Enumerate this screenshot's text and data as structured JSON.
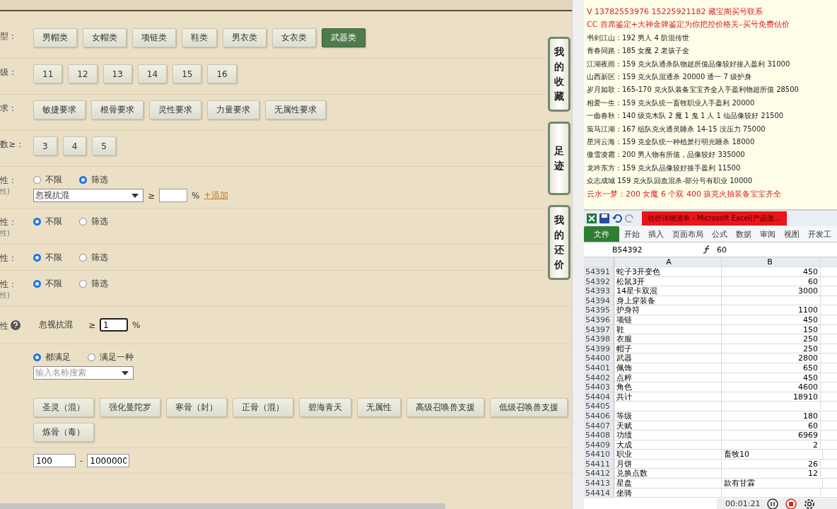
{
  "filters": [
    {
      "kind": "buttons",
      "label": "型：",
      "options": [
        {
          "label": "男帽类",
          "selected": false
        },
        {
          "label": "女帽类",
          "selected": false
        },
        {
          "label": "项链类",
          "selected": false
        },
        {
          "label": "鞋类",
          "selected": false
        },
        {
          "label": "男衣类",
          "selected": false
        },
        {
          "label": "女衣类",
          "selected": false
        },
        {
          "label": "武器类",
          "selected": true
        }
      ]
    },
    {
      "kind": "buttons",
      "label": "级：",
      "options": [
        {
          "label": "11",
          "selected": false
        },
        {
          "label": "12",
          "selected": false
        },
        {
          "label": "13",
          "selected": false
        },
        {
          "label": "14",
          "selected": false
        },
        {
          "label": "15",
          "selected": false
        },
        {
          "label": "16",
          "selected": false
        }
      ]
    },
    {
      "kind": "buttons",
      "label": "求：",
      "options": [
        {
          "label": "敏捷要求",
          "selected": false
        },
        {
          "label": "根骨要求",
          "selected": false
        },
        {
          "label": "灵性要求",
          "selected": false
        },
        {
          "label": "力量要求",
          "selected": false
        },
        {
          "label": "无属性要求",
          "selected": false
        }
      ]
    },
    {
      "kind": "buttons",
      "label": "数≥：",
      "options": [
        {
          "label": "3",
          "selected": false
        },
        {
          "label": "4",
          "selected": false
        },
        {
          "label": "5",
          "selected": false
        }
      ]
    },
    {
      "kind": "radio",
      "label": "性：",
      "sublabel": "性)",
      "options": [
        {
          "label": "不限",
          "selected": false
        },
        {
          "label": "筛选",
          "selected": true
        }
      ],
      "condition": {
        "select": "忽视抗混",
        "op": "≥",
        "unit": "%",
        "link": "+添加"
      }
    },
    {
      "kind": "radio",
      "label": "性：",
      "sublabel": "性)",
      "options": [
        {
          "label": "不限",
          "selected": true
        },
        {
          "label": "筛选",
          "selected": false
        }
      ]
    },
    {
      "kind": "radio",
      "label": "性：",
      "options": [
        {
          "label": "不限",
          "selected": true
        },
        {
          "label": "筛选",
          "selected": false
        }
      ]
    },
    {
      "kind": "radio",
      "label": "性：",
      "sublabel": "性)",
      "options": [
        {
          "label": "不限",
          "selected": true
        },
        {
          "label": "筛选",
          "selected": false
        }
      ]
    },
    {
      "kind": "threshold",
      "label": "性",
      "name": "忽视抗混",
      "op": "≥",
      "value": "1",
      "unit": "%"
    },
    {
      "kind": "multi",
      "options": [
        {
          "label": "都满足",
          "selected": true
        },
        {
          "label": "满足一种",
          "selected": false
        }
      ],
      "search": {
        "placeholder": "输入名称搜索"
      },
      "tags": [
        "圣灵（混）",
        "强化曼陀罗",
        "寒骨（封）",
        "正骨（混）",
        "碧海青天",
        "无属性",
        "高级召唤兽支援",
        "低级召唤兽支援",
        "炼骨（毒）"
      ]
    },
    {
      "kind": "range",
      "from": "100",
      "sep": "-",
      "to": "1000000"
    }
  ],
  "side_tabs": [
    "我的收藏",
    "足迹",
    "我的还价"
  ],
  "notes": [
    {
      "text": "V 13782553976    15225921182   藏宝阁买号联系",
      "emphasis": true
    },
    {
      "text": "CC 首席鉴定+大神金牌鉴定为你把控价格关–买号免费估价",
      "emphasis": true
    },
    {
      "text": "书剑江山：192 男人 4 阶混传世",
      "emphasis": false
    },
    {
      "text": "青春同路：185 女魔 2 老孩子全",
      "emphasis": false
    },
    {
      "text": "江湖夜雨：159 克火队通杀队物超所值品像较好接入盈利 31000",
      "emphasis": false
    },
    {
      "text": "山西新区：159 克火队混通杀 20000 通一 7 级护身",
      "emphasis": false
    },
    {
      "text": "岁月如歌：165-170 克火队装备宝宝齐全入手盈利物超所值 28500",
      "emphasis": false
    },
    {
      "text": "相爱一生：159 克火队统一畜牧职业入手盈利 20000",
      "emphasis": false
    },
    {
      "text": "一曲春秋：140 级克木队 2 魔 1 鬼 1 人 1 仙品像较好 21500",
      "emphasis": false
    },
    {
      "text": "策马江湖：167 组队克火通灵睡杀 14-15 没压力 75000",
      "emphasis": false
    },
    {
      "text": "星河云海：159 克全队统一种植景行明光睡杀 18000",
      "emphasis": false
    },
    {
      "text": "傲雪凌霜：200 男人物有所值，品像较好 335000",
      "emphasis": false
    },
    {
      "text": "龙吟东方：159 克火队品像较好接手盈利 11500",
      "emphasis": false
    },
    {
      "text": "众志成城 159 克火队回血混杀-部分号有职业 10000",
      "emphasis": false
    },
    {
      "text": "云水一梦：200 女魔 6 个双 400 孩克火抽装备宝宝齐全",
      "emphasis": true
    }
  ],
  "excel": {
    "title": "估价详细清单 - Microsoft Excel(产品激...",
    "tabs": [
      {
        "label": "文件",
        "selected": true
      },
      {
        "label": "开始",
        "selected": false
      },
      {
        "label": "插入",
        "selected": false
      },
      {
        "label": "页面布局",
        "selected": false
      },
      {
        "label": "公式",
        "selected": false
      },
      {
        "label": "数据",
        "selected": false
      },
      {
        "label": "审阅",
        "selected": false
      },
      {
        "label": "视图",
        "selected": false
      },
      {
        "label": "开发工",
        "selected": false
      }
    ],
    "name_box": "B54392",
    "formula": "60",
    "columns": [
      "A",
      "B"
    ],
    "rows": [
      {
        "num": "54391",
        "a": "蛇子3开变色",
        "b": "450",
        "kind": "number"
      },
      {
        "num": "54392",
        "a": "松鼠3开",
        "b": "60",
        "kind": "number"
      },
      {
        "num": "54393",
        "a": "14星卡双混",
        "b": "3000",
        "kind": "number"
      },
      {
        "num": "54394",
        "a": "身上穿装备",
        "kind": "number"
      },
      {
        "num": "54395",
        "a": "护身符",
        "b": "1100",
        "kind": "number"
      },
      {
        "num": "54396",
        "a": "项链",
        "b": "450",
        "kind": "number"
      },
      {
        "num": "54397",
        "a": "鞋",
        "b": "150",
        "kind": "number"
      },
      {
        "num": "54398",
        "a": "衣服",
        "b": "250",
        "kind": "number"
      },
      {
        "num": "54399",
        "a": "帽子",
        "b": "250",
        "kind": "number"
      },
      {
        "num": "54400",
        "a": "武器",
        "b": "2800",
        "kind": "number"
      },
      {
        "num": "54401",
        "a": "佩饰",
        "b": "650",
        "kind": "number"
      },
      {
        "num": "54402",
        "a": "点粹",
        "b": "450",
        "kind": "number"
      },
      {
        "num": "54403",
        "a": "角色",
        "b": "4600",
        "kind": "number"
      },
      {
        "num": "54404",
        "a": "共计",
        "b": "18910",
        "kind": "number"
      },
      {
        "num": "54405",
        "kind": "number"
      },
      {
        "num": "54406",
        "a": "等级",
        "b": "180",
        "kind": "number"
      },
      {
        "num": "54407",
        "a": "天赋",
        "b": "60",
        "kind": "number"
      },
      {
        "num": "54408",
        "a": "功绩",
        "b": "6969",
        "kind": "number"
      },
      {
        "num": "54409",
        "a": "大成",
        "b": "2",
        "kind": "number"
      },
      {
        "num": "54410",
        "a": "职业",
        "b": "畜牧10",
        "kind": "text"
      },
      {
        "num": "54411",
        "a": "月饼",
        "b": "26",
        "kind": "number"
      },
      {
        "num": "54412",
        "a": "兑换点数",
        "b": "12",
        "kind": "number"
      },
      {
        "num": "54413",
        "a": "星盘",
        "b": "款有甘霖",
        "kind": "text"
      },
      {
        "num": "54414",
        "a": "坐骑",
        "kind": "number"
      }
    ]
  },
  "recorder": {
    "time": "00:01:21"
  }
}
